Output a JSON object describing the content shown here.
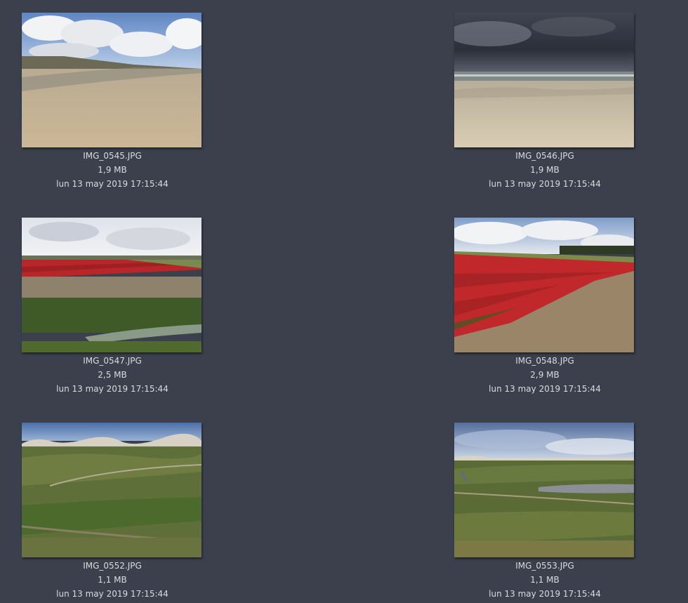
{
  "files": [
    {
      "name": "IMG_0545.JPG",
      "size": "1,9 MB",
      "date": "lun 13 may 2019 17:15:44",
      "scene": "beach-sunny"
    },
    {
      "name": "IMG_0546.JPG",
      "size": "1,9 MB",
      "date": "lun 13 may 2019 17:15:44",
      "scene": "beach-storm"
    },
    {
      "name": "IMG_0547.JPG",
      "size": "2,5 MB",
      "date": "lun 13 may 2019 17:15:44",
      "scene": "tulip-field-ditch"
    },
    {
      "name": "IMG_0548.JPG",
      "size": "2,9 MB",
      "date": "lun 13 may 2019 17:15:44",
      "scene": "tulip-field-rows"
    },
    {
      "name": "IMG_0552.JPG",
      "size": "1,1 MB",
      "date": "lun 13 may 2019 17:15:44",
      "scene": "dunes-heath"
    },
    {
      "name": "IMG_0553.JPG",
      "size": "1,1 MB",
      "date": "lun 13 may 2019 17:15:44",
      "scene": "dunes-water"
    }
  ],
  "colors": {
    "background": "#3b404c",
    "caption_text": "#d9dbe0"
  }
}
